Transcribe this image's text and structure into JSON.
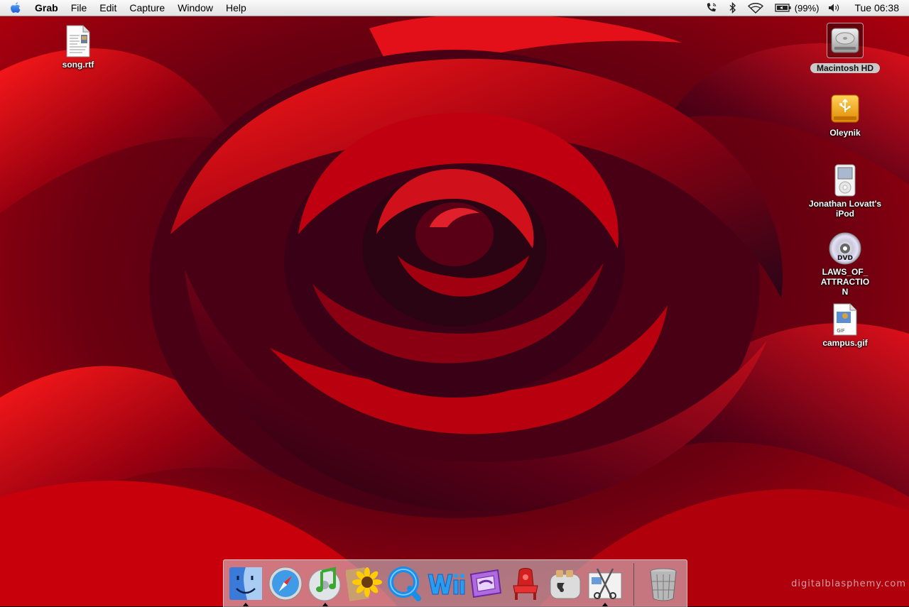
{
  "menubar": {
    "app_name": "Grab",
    "items": [
      "File",
      "Edit",
      "Capture",
      "Window",
      "Help"
    ],
    "battery_text": "(99%)",
    "clock": "Tue 06:38"
  },
  "desktop": {
    "icons": [
      {
        "label": "song.rtf",
        "icon": "rtf-document-icon"
      },
      {
        "label": "Macintosh HD",
        "icon": "hard-drive-icon",
        "selected": true
      },
      {
        "label": "Oleynik",
        "icon": "usb-drive-icon"
      },
      {
        "label": "Jonathan Lovatt's iPod",
        "icon": "ipod-icon"
      },
      {
        "label": "LAWS_OF_ATTRACTION",
        "icon": "dvd-icon"
      },
      {
        "label": "campus.gif",
        "icon": "gif-document-icon"
      }
    ]
  },
  "dock": {
    "items": [
      {
        "name": "Finder",
        "icon": "finder-icon",
        "running": true
      },
      {
        "name": "Safari",
        "icon": "safari-compass-icon",
        "running": false
      },
      {
        "name": "iTunes",
        "icon": "itunes-icon",
        "running": true
      },
      {
        "name": "iPhoto",
        "icon": "sunflower-icon",
        "running": false
      },
      {
        "name": "QuickTime Player",
        "icon": "quicktime-icon",
        "running": false
      },
      {
        "name": "Wii",
        "icon": "wii-logo-icon",
        "running": false
      },
      {
        "name": "Wii Channel",
        "icon": "wii-channel-icon",
        "running": false
      },
      {
        "name": "Red chair app",
        "icon": "red-chair-icon",
        "running": false
      },
      {
        "name": "Toast",
        "icon": "toaster-icon",
        "running": false
      },
      {
        "name": "Grab",
        "icon": "grab-scissors-icon",
        "running": true
      },
      {
        "name": "Trash",
        "icon": "trash-icon",
        "running": false
      }
    ]
  },
  "watermark": "digitalblasphemy.com",
  "colors": {
    "wallpaper_main": "#b00010",
    "wallpaper_shadow": "#2a0418",
    "menubar": "#ececec"
  }
}
